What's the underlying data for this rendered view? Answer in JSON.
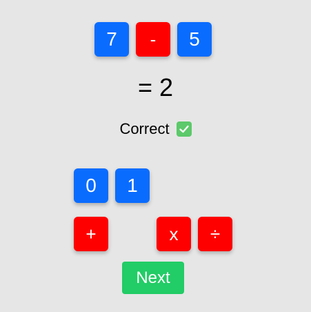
{
  "equation": {
    "operand1": "7",
    "operator": "-",
    "operand2": "5"
  },
  "result_text": "= 2",
  "feedback": {
    "text": "Correct",
    "icon": "check-mark-icon"
  },
  "digit_tiles": [
    "0",
    "1"
  ],
  "operator_tiles": [
    "+",
    "x",
    "÷"
  ],
  "next_label": "Next",
  "colors": {
    "background": "#e6e6e6",
    "number_tile": "#0a6cff",
    "operator_tile": "#ff0000",
    "next_button": "#22cc66",
    "check_icon": "#5cc96a"
  }
}
